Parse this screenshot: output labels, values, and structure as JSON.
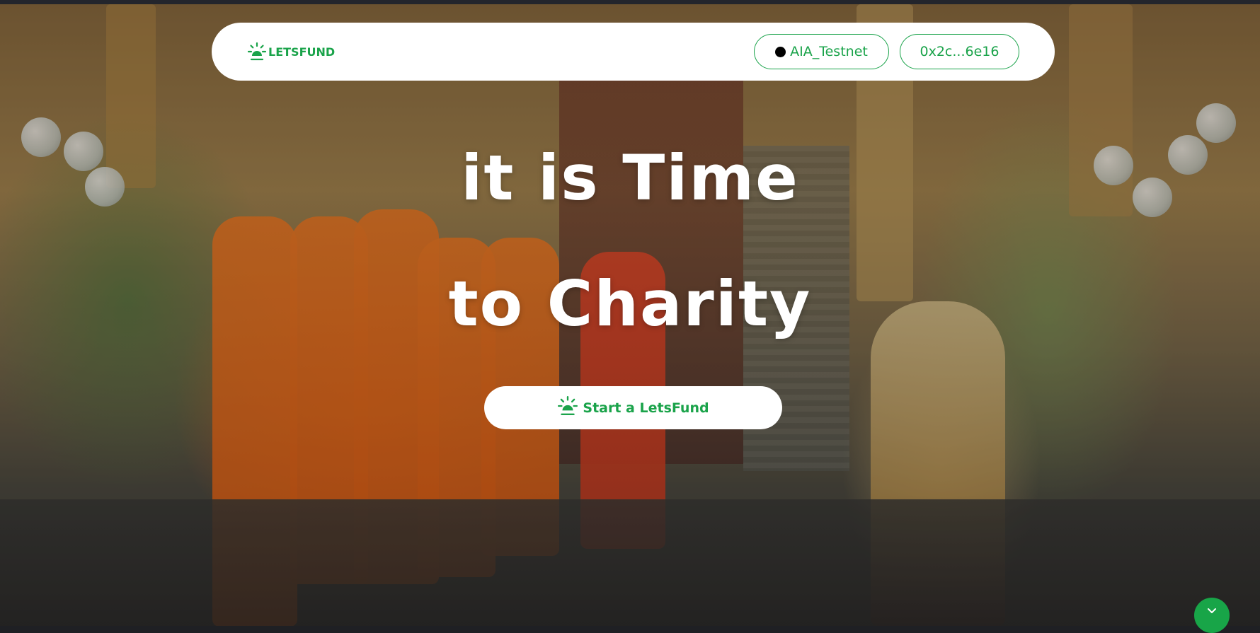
{
  "navbar": {
    "brand_name": "LETSFUND",
    "brand_icon": "sun-sprout-icon",
    "network_label": "AIA_Testnet",
    "network_icon": "network-status-dot",
    "wallet_address": "0x2c...6e16"
  },
  "hero": {
    "headline_line1": "it is Time",
    "headline_line2": "to Charity",
    "cta_label": "Start a LetsFund",
    "cta_icon": "sun-sprout-icon",
    "background_image": "monks-receiving-alms-photo"
  },
  "scroll_button": {
    "icon": "chevron-down-icon"
  },
  "colors": {
    "accent": "#1aa34a",
    "navbar_bg": "#ffffff",
    "headline": "#ffffff"
  }
}
